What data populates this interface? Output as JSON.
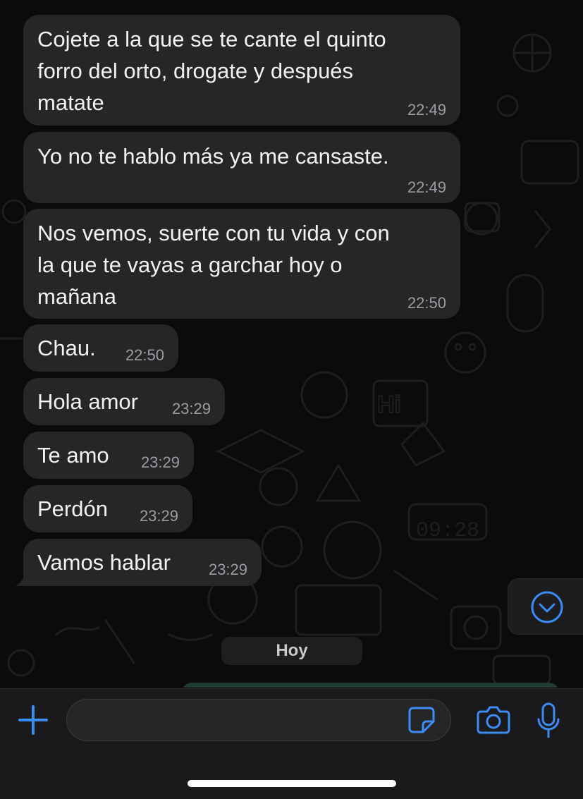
{
  "chat": {
    "messages": [
      {
        "text": "Cojete a la que se te cante el quinto\nforro del orto, drogate y después\nmatate",
        "time": "22:49"
      },
      {
        "text": "Yo no te hablo más ya me cansaste.",
        "time": "22:49"
      },
      {
        "text": "Nos vemos, suerte con tu vida y con\nla que te vayas a garchar hoy o\nmañana",
        "time": "22:50"
      },
      {
        "text": "Chau.",
        "time": "22:50"
      },
      {
        "text": "Hola amor",
        "time": "23:29"
      },
      {
        "text": "Te amo",
        "time": "23:29"
      },
      {
        "text": "Perdón",
        "time": "23:29"
      },
      {
        "text": "Vamos hablar",
        "time": "23:29"
      }
    ],
    "day_separator": "Hoy",
    "background_doodle_clock": "09:28",
    "background_doodle_greeting": "Hi"
  },
  "composer": {
    "input_value": "",
    "icons": [
      "plus-icon",
      "sticker-icon",
      "camera-icon",
      "microphone-icon"
    ]
  },
  "icons": {
    "scroll_down": "chevron-down-circle-icon"
  },
  "colors": {
    "accent": "#3b8cf5",
    "incoming_bubble": "#262628",
    "background": "#0b0b0b",
    "outgoing_bubble": "#1f3b32"
  }
}
